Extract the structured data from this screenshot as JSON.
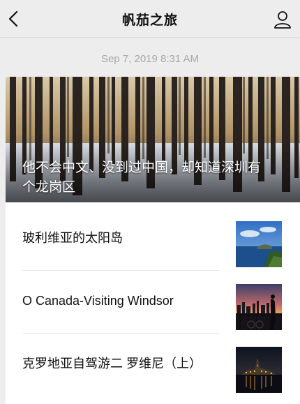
{
  "nav": {
    "title": "帆茄之旅",
    "back_icon": "chevron-left-icon",
    "profile_icon": "person-icon"
  },
  "timestamp": "Sep 7, 2019 8:31 AM",
  "hero": {
    "title": "他不会中文、没到过中国，却知道深圳有个龙岗区",
    "image": "snowy-forest-photo"
  },
  "articles": [
    {
      "title": "玻利维亚的太阳岛",
      "image": "lake-island-photo"
    },
    {
      "title": "O Canada-Visiting Windsor",
      "image": "sunset-skyline-photo"
    },
    {
      "title": "克罗地亚自驾游二  罗维尼（上）",
      "image": "night-harbor-photo"
    }
  ],
  "colors": {
    "background": "#ededed",
    "card": "#ffffff",
    "timestamp": "#a8a8a8"
  }
}
